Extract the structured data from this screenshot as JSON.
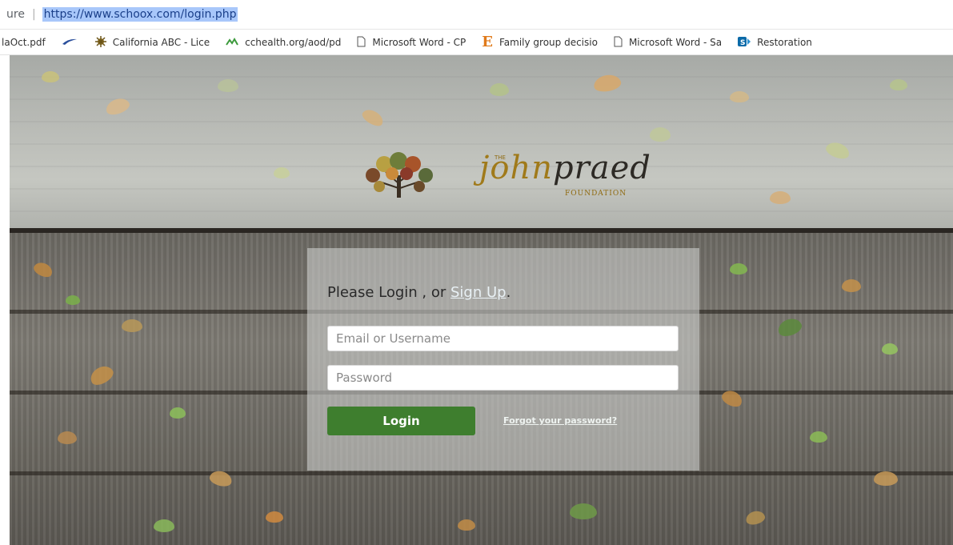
{
  "browser": {
    "security_label": "ure",
    "url": "https://www.schoox.com/login.php",
    "bookmarks": [
      {
        "label": "laOct.pdf",
        "icon": "none"
      },
      {
        "label": "",
        "icon": "swoosh-icon"
      },
      {
        "label": "California ABC - Lice",
        "icon": "sun-seal-icon"
      },
      {
        "label": "cchealth.org/aod/pd",
        "icon": "green-wave-icon"
      },
      {
        "label": "Microsoft Word - CP",
        "icon": "page-icon"
      },
      {
        "label": "Family group decisio",
        "icon": "e-letter-icon"
      },
      {
        "label": "Microsoft Word - Sa",
        "icon": "page-icon"
      },
      {
        "label": "Restoration",
        "icon": "sharepoint-icon"
      }
    ]
  },
  "logo": {
    "script_light": "john",
    "script_dark": "praed",
    "the": "THE",
    "sub": "FOUNDATION"
  },
  "login": {
    "heading_prefix": "Please Login , or ",
    "signup_label": "Sign Up",
    "heading_suffix": ".",
    "username_placeholder": "Email or Username",
    "password_placeholder": "Password",
    "login_label": "Login",
    "forgot_label": "Forgot your password?"
  },
  "colors": {
    "login_button": "#3e7e2e",
    "url_highlight": "#a8c7fa",
    "logo_gold": "#a07a1a"
  }
}
